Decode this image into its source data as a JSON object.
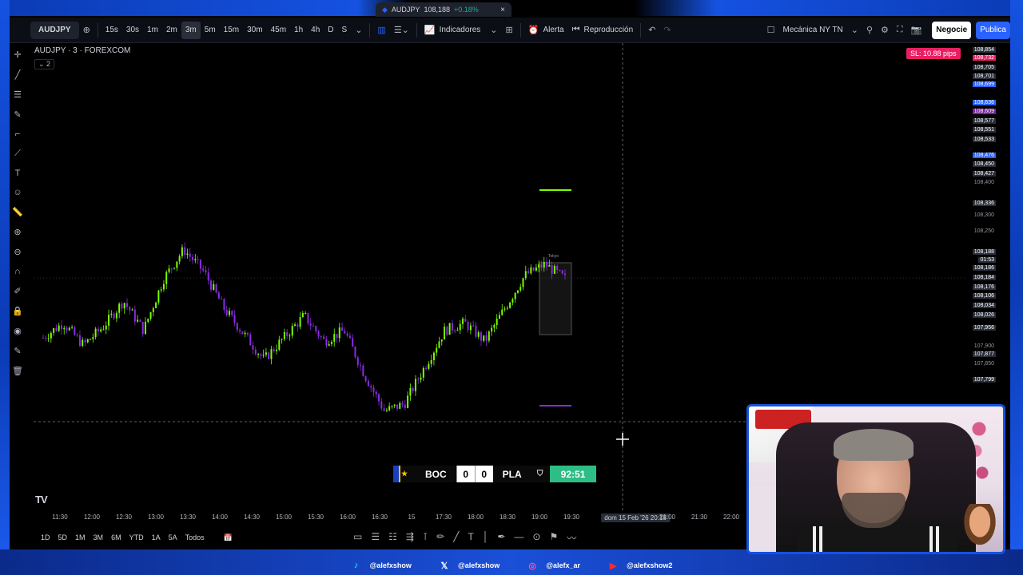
{
  "window_tab": {
    "symbol": "AUDJPY",
    "price": "108,188",
    "change": "+0.18%"
  },
  "toolbar": {
    "symbol": "AUDJPY",
    "intervals": [
      "15s",
      "30s",
      "1m",
      "2m",
      "3m",
      "5m",
      "15m",
      "30m",
      "45m",
      "1h",
      "4h",
      "D",
      "S"
    ],
    "active_interval": "3m",
    "indicators_label": "Indicadores",
    "alert_label": "Alerta",
    "replay_label": "Reproducción",
    "layout_name": "Mecánica NY TN",
    "negocie_label": "Negocie",
    "publish_label": "Publica"
  },
  "legend": {
    "title": "AUDJPY · 3 · FOREXCOM",
    "sub": "2"
  },
  "sl_badge": "SL: 10.88 pips",
  "price_axis": [
    {
      "label": "108,854",
      "color": "#2a2e39"
    },
    {
      "label": "108,732",
      "color": "#e91e63"
    },
    {
      "label": "108,705",
      "color": "#2a2e39"
    },
    {
      "label": "108,701",
      "color": "#2a2e39"
    },
    {
      "label": "108,699",
      "color": "#2962ff"
    },
    {
      "label": "108,636",
      "color": "#2962ff"
    },
    {
      "label": "108,609",
      "color": "#7b1fa2"
    },
    {
      "label": "108,577",
      "color": "#2a2e39"
    },
    {
      "label": "108,551",
      "color": "#2a2e39"
    },
    {
      "label": "108,533",
      "color": "#2a2e39"
    },
    {
      "label": "108,476",
      "color": "#2962ff"
    },
    {
      "label": "108,450",
      "color": "#2a2e39"
    },
    {
      "label": "108,427",
      "color": "#2a2e39"
    },
    {
      "label": "108,400",
      "color": ""
    },
    {
      "label": "108,336",
      "color": "#2a2e39"
    },
    {
      "label": "108,300",
      "color": ""
    },
    {
      "label": "108,250",
      "color": ""
    },
    {
      "label": "108,188",
      "color": "#2a2e39"
    },
    {
      "label": "01:53",
      "color": "#2a2e39"
    },
    {
      "label": "108,186",
      "color": "#2a2e39"
    },
    {
      "label": "108,184",
      "color": "#2a2e39"
    },
    {
      "label": "108,176",
      "color": "#2a2e39"
    },
    {
      "label": "108,106",
      "color": "#2a2e39"
    },
    {
      "label": "108,034",
      "color": "#2a2e39"
    },
    {
      "label": "108,026",
      "color": "#2a2e39"
    },
    {
      "label": "107,956",
      "color": "#2a2e39"
    },
    {
      "label": "107,900",
      "color": ""
    },
    {
      "label": "107,877",
      "color": "#2a2e39"
    },
    {
      "label": "107,850",
      "color": ""
    },
    {
      "label": "107,799",
      "color": "#2a2e39"
    }
  ],
  "time_axis": [
    "11:30",
    "12:00",
    "12:30",
    "13:00",
    "13:30",
    "14:00",
    "14:30",
    "15:00",
    "15:30",
    "16:00",
    "16:30",
    "15",
    "17:30",
    "18:00",
    "18:30",
    "19:00",
    "19:30",
    "dom 15 Feb '26   20:18",
    "21:00",
    "21:30",
    "22:00"
  ],
  "cursor_time": "dom 15 Feb '26   20:18",
  "session_label": "Tokyo",
  "ranges": [
    "1D",
    "5D",
    "1M",
    "3M",
    "6M",
    "YTD",
    "1A",
    "5A",
    "Todos"
  ],
  "chart_data": {
    "type": "candlestick",
    "symbol": "AUDJPY",
    "interval": "3m",
    "up_color": "#7cfc00",
    "down_color": "#8a2be2",
    "close_path": [
      108.02,
      108.06,
      108.0,
      108.05,
      108.12,
      108.04,
      108.18,
      108.26,
      108.2,
      108.1,
      108.03,
      107.96,
      108.02,
      108.08,
      108.01,
      108.04,
      107.92,
      107.82,
      107.84,
      107.94,
      108.04,
      108.06,
      108.01,
      108.1,
      108.19,
      108.22,
      108.18
    ]
  },
  "scoreboard": {
    "home": "BOC",
    "home_score": "0",
    "away_score": "0",
    "away": "PLA",
    "clock": "92:51"
  },
  "socials": [
    {
      "icon": "tiktok-icon",
      "handle": "@alefxshow"
    },
    {
      "icon": "x-icon",
      "handle": "@alefxshow"
    },
    {
      "icon": "instagram-icon",
      "handle": "@alefx_ar"
    },
    {
      "icon": "youtube-icon",
      "handle": "@alefxshow2"
    }
  ]
}
